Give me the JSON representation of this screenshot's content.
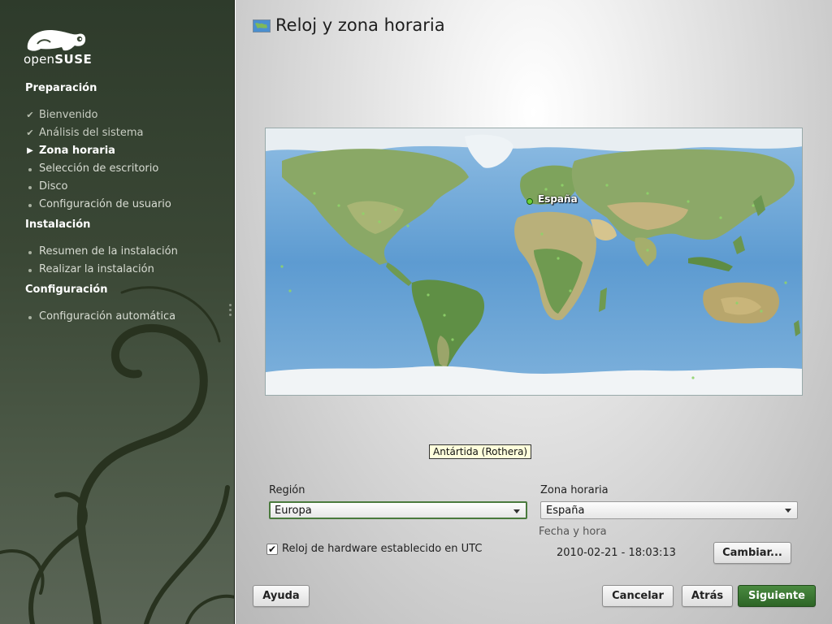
{
  "sidebar": {
    "logo_text_light": "open",
    "logo_text_bold": "SUSE",
    "sections": [
      {
        "title": "Preparación"
      },
      {
        "title": "Instalación"
      },
      {
        "title": "Configuración"
      }
    ],
    "steps": [
      {
        "label": "Bienvenido",
        "state": "done"
      },
      {
        "label": "Análisis del sistema",
        "state": "done"
      },
      {
        "label": "Zona horaria",
        "state": "current"
      },
      {
        "label": "Selección de escritorio",
        "state": "todo"
      },
      {
        "label": "Disco",
        "state": "todo"
      },
      {
        "label": "Configuración de usuario",
        "state": "todo"
      },
      {
        "label": "Resumen de la instalación",
        "state": "todo"
      },
      {
        "label": "Realizar la instalación",
        "state": "todo"
      },
      {
        "label": "Configuración automática",
        "state": "todo"
      }
    ]
  },
  "main": {
    "title": "Reloj y zona horaria",
    "map": {
      "selected_label": "España"
    },
    "tooltip": "Antártida (Rothera)",
    "region": {
      "label": "Región",
      "value": "Europa"
    },
    "timezone": {
      "label": "Zona horaria",
      "value": "España"
    },
    "hw_clock": {
      "label": "Reloj de hardware establecido en UTC",
      "checked": true
    },
    "datetime": {
      "label": "Fecha y hora",
      "value": "2010-02-21 - 18:03:13",
      "change_button": "Cambiar..."
    }
  },
  "buttons": {
    "help": "Ayuda",
    "cancel": "Cancelar",
    "back": "Atrás",
    "next": "Siguiente"
  },
  "colors": {
    "sidebar_bg": "#3a4735",
    "accent": "#2d6526",
    "tooltip_bg": "#ffffdc"
  }
}
